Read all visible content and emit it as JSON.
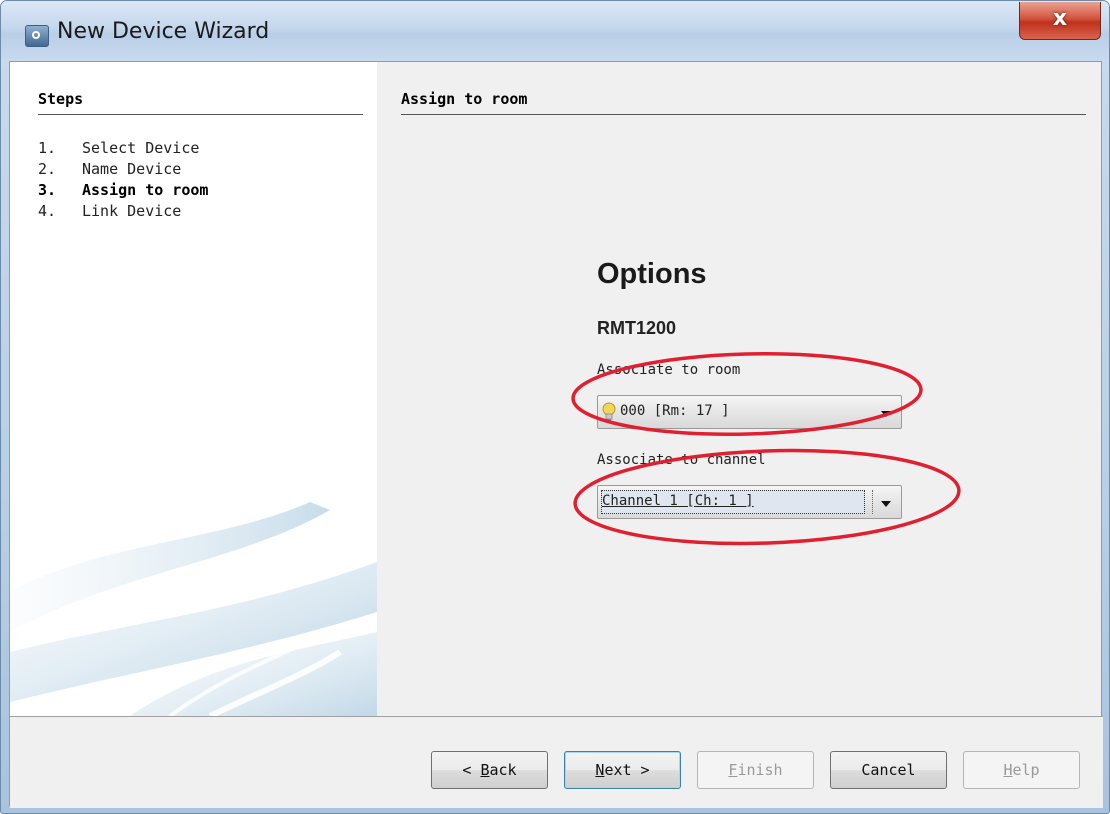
{
  "window": {
    "title": "New Device Wizard",
    "close_glyph": "x"
  },
  "steps": {
    "heading": "Steps",
    "items": [
      {
        "num": "1.",
        "label": "Select Device"
      },
      {
        "num": "2.",
        "label": "Name Device"
      },
      {
        "num": "3.",
        "label": "Assign to room",
        "current": true
      },
      {
        "num": "4.",
        "label": "Link Device"
      }
    ]
  },
  "content": {
    "heading": "Assign to room",
    "options_title": "Options",
    "device_name": "RMT1200",
    "room": {
      "label": "Associate to room",
      "value": "000 [Rm: 17 ]",
      "icon": "lightbulb-icon"
    },
    "channel": {
      "label": "Associate to channel",
      "value": "Channel 1 [Ch: 1 ]"
    }
  },
  "buttons": {
    "back": {
      "prefix": "< ",
      "mnemonic": "B",
      "rest": "ack"
    },
    "next": {
      "mnemonic": "N",
      "rest": "ext >"
    },
    "finish": {
      "mnemonic": "F",
      "rest": "inish"
    },
    "cancel": {
      "label": "Cancel"
    },
    "help": {
      "mnemonic": "H",
      "rest": "elp"
    }
  },
  "colors": {
    "annotation": "#e02030",
    "close_button": "#c0321d",
    "primary_border": "#3c7fb1"
  }
}
